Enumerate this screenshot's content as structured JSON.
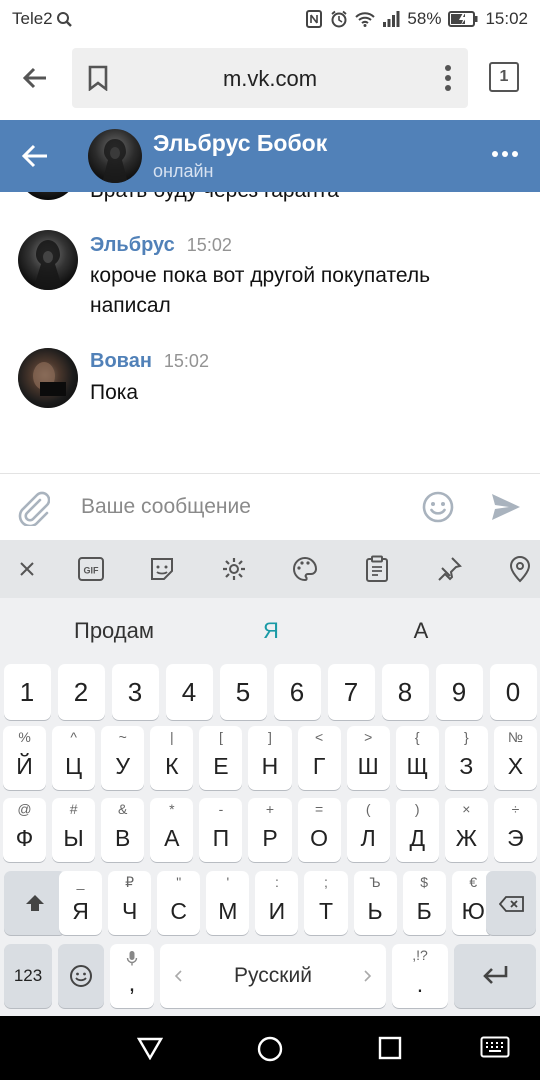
{
  "status_bar": {
    "carrier": "Tele2",
    "battery": "58%",
    "time": "15:02"
  },
  "browser": {
    "url": "m.vk.com",
    "tab_count": "1"
  },
  "chat_header": {
    "name": "Эльбрус Бобок",
    "status": "онлайн"
  },
  "messages": [
    {
      "author": "Эльбрус",
      "time": "15:02",
      "text": "короче пока вот другой покупатель написал"
    },
    {
      "author": "Вован",
      "time": "15:02",
      "text": "Пока"
    }
  ],
  "partial_message_text": "Брать буду через гаранта",
  "composer": {
    "placeholder": "Ваше сообщение"
  },
  "keyboard": {
    "toolbar": [
      "close",
      "gif",
      "sticker",
      "settings",
      "theme",
      "clipboard",
      "pin",
      "location"
    ],
    "gif_label": "GIF",
    "suggestions": [
      "Продам",
      "Я",
      "А"
    ],
    "suggestion_highlight_color": "#1a9aa6",
    "numbers": [
      "1",
      "2",
      "3",
      "4",
      "5",
      "6",
      "7",
      "8",
      "9",
      "0"
    ],
    "row1": [
      {
        "l": "Й",
        "s": "%"
      },
      {
        "l": "Ц",
        "s": "^"
      },
      {
        "l": "У",
        "s": "~"
      },
      {
        "l": "К",
        "s": "|"
      },
      {
        "l": "Е",
        "s": "["
      },
      {
        "l": "Н",
        "s": "]"
      },
      {
        "l": "Г",
        "s": "<"
      },
      {
        "l": "Ш",
        "s": ">"
      },
      {
        "l": "Щ",
        "s": "{"
      },
      {
        "l": "З",
        "s": "}"
      },
      {
        "l": "Х",
        "s": "№"
      }
    ],
    "row2": [
      {
        "l": "Ф",
        "s": "@"
      },
      {
        "l": "Ы",
        "s": "#"
      },
      {
        "l": "В",
        "s": "&"
      },
      {
        "l": "А",
        "s": "*"
      },
      {
        "l": "П",
        "s": "-"
      },
      {
        "l": "Р",
        "s": "+"
      },
      {
        "l": "О",
        "s": "="
      },
      {
        "l": "Л",
        "s": "("
      },
      {
        "l": "Д",
        "s": ")"
      },
      {
        "l": "Ж",
        "s": "×"
      },
      {
        "l": "Э",
        "s": "÷"
      }
    ],
    "row3": [
      {
        "l": "Я",
        "s": "_"
      },
      {
        "l": "Ч",
        "s": "₽"
      },
      {
        "l": "С",
        "s": "\""
      },
      {
        "l": "М",
        "s": "'"
      },
      {
        "l": "И",
        "s": ":"
      },
      {
        "l": "Т",
        "s": ";"
      },
      {
        "l": "Ь",
        "s": "Ъ"
      },
      {
        "l": "Б",
        "s": "$"
      },
      {
        "l": "Ю",
        "s": "€"
      }
    ],
    "symbols_key": "123",
    "space_label": "Русский",
    "period_key": {
      "l": ".",
      "s": ",!?"
    }
  }
}
